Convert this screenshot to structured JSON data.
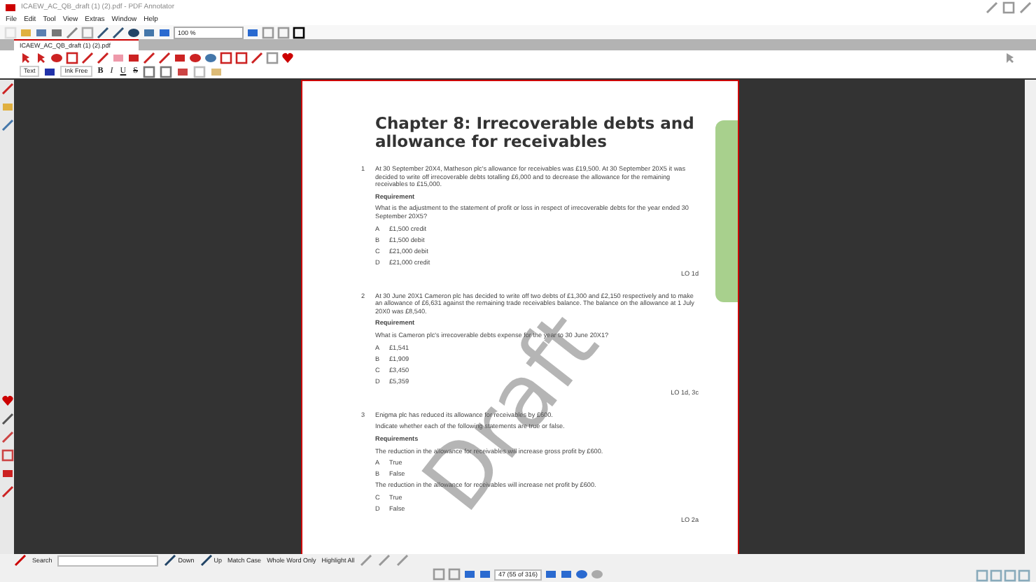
{
  "window": {
    "title": "ICAEW_AC_QB_draft (1) (2).pdf - PDF Annotator"
  },
  "menu": [
    "File",
    "Edit",
    "Tool",
    "View",
    "Extras",
    "Window",
    "Help"
  ],
  "toolbar": {
    "zoom": "100 %"
  },
  "tabs": [
    {
      "label": "ICAEW_AC_QB_draft (1) (2).pdf",
      "selected": true
    }
  ],
  "format_bar": {
    "style": "Text",
    "font": "Ink Free",
    "bold": "B",
    "italic": "I",
    "underline": "U",
    "strike": "S"
  },
  "document": {
    "chapter_title": "Chapter 8: Irrecoverable debts and allowance for receivables",
    "watermark": "Draft",
    "questions": [
      {
        "number": "1",
        "blocks": [
          {
            "kind": "para",
            "text": "At 30 September 20X4, Matheson plc's allowance for receivables was £19,500. At 30 September 20X5 it was decided to write off irrecoverable debts totalling £6,000 and to decrease the allowance for the remaining receivables to £15,000."
          },
          {
            "kind": "heading",
            "text": "Requirement"
          },
          {
            "kind": "para",
            "text": "What is the adjustment to the statement of profit or loss in respect of irrecoverable debts for the year ended 30 September 20X5?"
          },
          {
            "kind": "option",
            "letter": "A",
            "text": "£1,500 credit"
          },
          {
            "kind": "option",
            "letter": "B",
            "text": "£1,500 debit"
          },
          {
            "kind": "option",
            "letter": "C",
            "text": "£21,000 debit"
          },
          {
            "kind": "option",
            "letter": "D",
            "text": "£21,000 credit"
          },
          {
            "kind": "lo",
            "text": "LO 1d"
          }
        ]
      },
      {
        "number": "2",
        "blocks": [
          {
            "kind": "para",
            "text": "At 30 June 20X1 Cameron plc has decided to write off two debts of £1,300 and £2,150 respectively and to make an allowance of £6,631 against the remaining trade receivables balance. The balance on the allowance at 1 July 20X0 was £8,540."
          },
          {
            "kind": "heading",
            "text": "Requirement"
          },
          {
            "kind": "para",
            "text": "What is Cameron plc's irrecoverable debts expense for the year to 30 June 20X1?"
          },
          {
            "kind": "option",
            "letter": "A",
            "text": "£1,541"
          },
          {
            "kind": "option",
            "letter": "B",
            "text": "£1,909"
          },
          {
            "kind": "option",
            "letter": "C",
            "text": "£3,450"
          },
          {
            "kind": "option",
            "letter": "D",
            "text": "£5,359"
          },
          {
            "kind": "lo",
            "text": "LO 1d, 3c"
          }
        ]
      },
      {
        "number": "3",
        "blocks": [
          {
            "kind": "para",
            "text": "Enigma plc has reduced its allowance for receivables by £600."
          },
          {
            "kind": "para",
            "text": "Indicate whether each of the following statements are true or false."
          },
          {
            "kind": "heading",
            "text": "Requirements"
          },
          {
            "kind": "para",
            "text": "The reduction in the allowance for receivables will increase gross profit by £600."
          },
          {
            "kind": "option",
            "letter": "A",
            "text": "True"
          },
          {
            "kind": "option",
            "letter": "B",
            "text": "False"
          },
          {
            "kind": "para",
            "text": "The reduction in the allowance for receivables will increase net profit by £600."
          },
          {
            "kind": "option",
            "letter": "C",
            "text": "True"
          },
          {
            "kind": "option",
            "letter": "D",
            "text": "False"
          },
          {
            "kind": "lo",
            "text": "LO 2a"
          }
        ]
      }
    ]
  },
  "search": {
    "label": "Search",
    "down": "Down",
    "up": "Up",
    "options": [
      "Match Case",
      "Whole Word Only",
      "Highlight All"
    ]
  },
  "status_bar": {
    "page": "47 (55 of 316)"
  }
}
